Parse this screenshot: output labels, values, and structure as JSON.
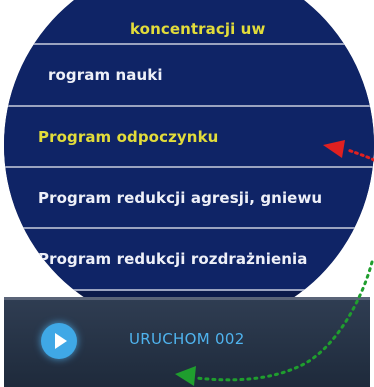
{
  "menu": {
    "items": [
      {
        "label": "koncentracji uw"
      },
      {
        "label": "rogram nauki"
      },
      {
        "label": "Program odpoczynku"
      },
      {
        "label": "Program redukcji agresji, gniewu"
      },
      {
        "label": "Program redukcji rozdrażnienia"
      }
    ],
    "selected_index": 2
  },
  "action_bar": {
    "run_label": "URUCHOM 002",
    "icon": "play-icon"
  },
  "annotations": {
    "red_arrow_color": "#e02020",
    "green_arrow_color": "#1f9e2e"
  }
}
